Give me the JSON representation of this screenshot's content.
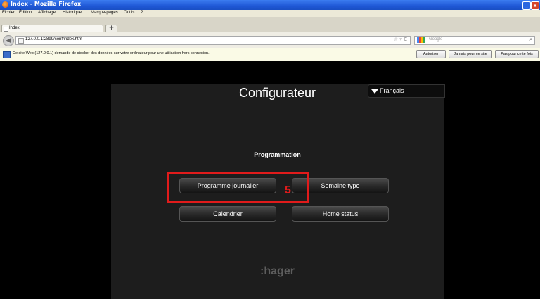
{
  "window": {
    "title": "Index - Mozilla Firefox",
    "minimize": "_",
    "close": "x"
  },
  "menu": [
    "Fichier",
    "Édition",
    "Affichage",
    "Historique",
    "Marque-pages",
    "Outils",
    "?"
  ],
  "tab": {
    "title": "Index",
    "new_tab": "+"
  },
  "nav": {
    "back": "◀",
    "url": "127.0.0.1:2899/conf/index.htm",
    "url_icons": "☆ ▿ C",
    "search_placeholder": "Google",
    "search_icon": "⌕"
  },
  "notification": {
    "text": "Ce site Web (127.0.0.1) demande de stocker des données sur votre ordinateur pour une utilisation hors connexion.",
    "buttons": [
      "Autoriser",
      "Jamais pour ce site",
      "Pas pour cette fois"
    ]
  },
  "app": {
    "title": "Configurateur",
    "language": "Français",
    "section": "Programmation",
    "buttons": [
      "Programme journalier",
      "Semaine type",
      "Calendrier",
      "Home status"
    ],
    "logo": ":hager"
  },
  "annotation": {
    "step": "5",
    "color": "#e11b1b"
  }
}
